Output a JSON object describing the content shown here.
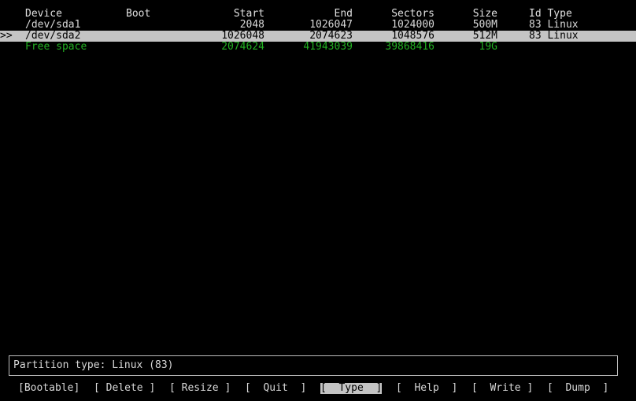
{
  "table": {
    "headers": {
      "device": "Device",
      "boot": "Boot",
      "start": "Start",
      "end": "End",
      "sectors": "Sectors",
      "size": "Size",
      "id_type": "Id Type"
    },
    "rows": [
      {
        "pointer": "",
        "device": "/dev/sda1",
        "boot": "",
        "start": "2048",
        "end": "1026047",
        "sectors": "1024000",
        "size": "500M",
        "id_type": "83 Linux"
      },
      {
        "pointer": ">>",
        "device": "/dev/sda2",
        "boot": "",
        "start": "1026048",
        "end": "2074623",
        "sectors": "1048576",
        "size": "512M",
        "id_type": "83 Linux"
      },
      {
        "pointer": "",
        "device": "Free space",
        "boot": "",
        "start": "2074624",
        "end": "41943039",
        "sectors": "39868416",
        "size": "19G",
        "id_type": ""
      }
    ]
  },
  "status": {
    "text": "Partition type: Linux (83)"
  },
  "menu": {
    "items": [
      {
        "label": "[Bootable]"
      },
      {
        "label": "[ Delete ]"
      },
      {
        "label": "[ Resize ]"
      },
      {
        "label": "[  Quit  ]"
      },
      {
        "label": "[  Type  ]"
      },
      {
        "label": "[  Help  ]"
      },
      {
        "label": "[  Write ]"
      },
      {
        "label": "[  Dump  ]"
      }
    ],
    "selected_index": 4
  },
  "colors": {
    "background": "#000000",
    "text": "#d8d8d8",
    "selection_bg": "#c4c4c4",
    "free_space": "#22b022"
  }
}
